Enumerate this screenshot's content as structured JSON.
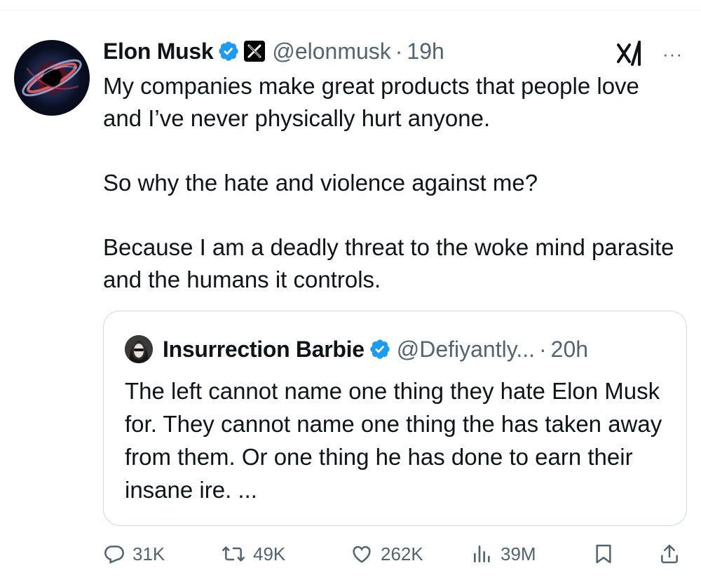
{
  "author": {
    "name": "Elon Musk",
    "handle": "@elonmusk",
    "separator": "·",
    "time": "19h"
  },
  "tweet": {
    "paragraphs": [
      "My companies make great products that people love and I’ve never physically hurt anyone.",
      "So why the hate and violence against me?",
      "Because I am a deadly threat to the woke mind parasite and the humans it controls."
    ]
  },
  "quoted": {
    "name": "Insurrection Barbie",
    "handle": "@Defiyantly...",
    "separator": "·",
    "time": "20h",
    "text": "The left cannot name one thing they hate Elon Musk for. They cannot name one thing the has taken away from them. Or one thing he has done to earn their insane ire. ..."
  },
  "actions": {
    "replies": "31K",
    "reposts": "49K",
    "likes": "262K",
    "views": "39M"
  },
  "icons": {
    "verified": "verified-badge-icon",
    "x_affiliate": "x-affiliate-badge-icon",
    "grok": "grok-icon",
    "more": "more-icon",
    "reply": "reply-icon",
    "repost": "repost-icon",
    "like": "like-icon",
    "views": "views-icon",
    "bookmark": "bookmark-icon",
    "share": "share-icon"
  },
  "colors": {
    "text": "#0f1419",
    "secondary": "#536471",
    "verified_blue": "#1d9bf0",
    "border": "#cfd9de"
  }
}
